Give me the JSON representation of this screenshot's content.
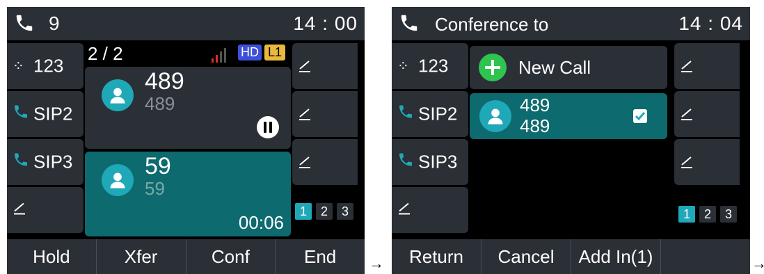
{
  "screen1": {
    "topbar": {
      "line_number": "9",
      "time": "14 : 00"
    },
    "left_keys": [
      {
        "label": "123"
      },
      {
        "label": "SIP2"
      },
      {
        "label": "SIP3"
      },
      {
        "label": ""
      }
    ],
    "call_header": {
      "counter": "2 / 2",
      "hd_badge": "HD",
      "line_badge": "L1"
    },
    "calls": [
      {
        "name": "489",
        "number": "489",
        "state": "held"
      },
      {
        "name": "59",
        "number": "59",
        "duration": "00:06",
        "state": "active"
      }
    ],
    "pages": [
      "1",
      "2",
      "3"
    ],
    "softkeys": [
      "Hold",
      "Xfer",
      "Conf",
      "End"
    ]
  },
  "screen2": {
    "topbar": {
      "title": "Conference to",
      "time": "14 : 04"
    },
    "left_keys": [
      {
        "label": "123"
      },
      {
        "label": "SIP2"
      },
      {
        "label": "SIP3"
      },
      {
        "label": ""
      }
    ],
    "new_call_label": "New Call",
    "contact": {
      "name": "489",
      "number": "489"
    },
    "pages": [
      "1",
      "2",
      "3"
    ],
    "softkeys": [
      "Return",
      "Cancel",
      "Add In(1)",
      ""
    ]
  },
  "arrow_glyph": "→",
  "colors": {
    "accent_teal": "#1fa8b8",
    "active_call_bg": "#0d6a6e",
    "new_call_green": "#2ec44f",
    "bar_gray": "#2b2f36"
  }
}
